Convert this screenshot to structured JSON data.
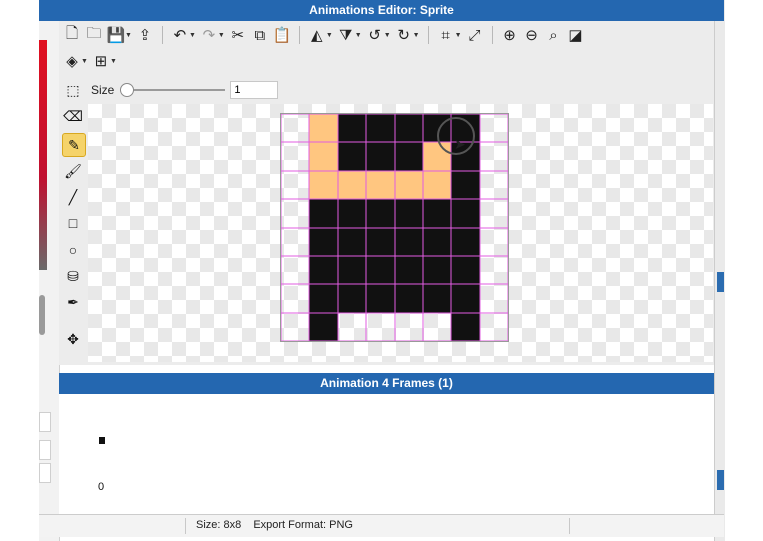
{
  "window": {
    "title": "Animations Editor: Sprite"
  },
  "toolbar": {
    "row1": [
      {
        "icon": "new-file-icon",
        "glyph": "🗋"
      },
      {
        "icon": "open-folder-icon",
        "glyph": "🗀"
      },
      {
        "icon": "save-icon",
        "glyph": "💾",
        "caret": true
      },
      {
        "icon": "export-icon",
        "glyph": "⇪"
      },
      {
        "sep": true
      },
      {
        "icon": "undo-icon",
        "glyph": "↶",
        "caret": true
      },
      {
        "icon": "redo-icon",
        "glyph": "↷",
        "caret": true,
        "disabled": true
      },
      {
        "icon": "cut-icon",
        "glyph": "✂"
      },
      {
        "icon": "copy-icon",
        "glyph": "⧉"
      },
      {
        "icon": "paste-icon",
        "glyph": "📋"
      },
      {
        "sep": true
      },
      {
        "icon": "flip-horizontal-icon",
        "glyph": "◭",
        "caret": true
      },
      {
        "icon": "flip-vertical-icon",
        "glyph": "⧩",
        "caret": true
      },
      {
        "icon": "rotate-left-icon",
        "glyph": "↺",
        "caret": true
      },
      {
        "icon": "rotate-right-icon",
        "glyph": "↻",
        "caret": true
      },
      {
        "sep": true
      },
      {
        "icon": "crop-icon",
        "glyph": "⌗",
        "caret": true
      },
      {
        "icon": "resize-icon",
        "glyph": "⤢"
      },
      {
        "sep": true
      },
      {
        "icon": "zoom-in-icon",
        "glyph": "⊕"
      },
      {
        "icon": "zoom-out-icon",
        "glyph": "⊖"
      },
      {
        "icon": "zoom-fit-icon",
        "glyph": "⌕"
      },
      {
        "icon": "background-toggle-icon",
        "glyph": "◪"
      }
    ],
    "row2": [
      {
        "icon": "layers-icon",
        "glyph": "◈",
        "caret": true
      },
      {
        "icon": "grid-icon",
        "glyph": "⊞",
        "caret": true
      }
    ]
  },
  "size": {
    "label": "Size",
    "value": "1",
    "slider_fraction": 0
  },
  "tools": [
    {
      "icon": "selection-icon",
      "glyph": "⬚"
    },
    {
      "icon": "eraser-icon",
      "glyph": "⌫"
    },
    {
      "icon": "pencil-icon",
      "glyph": "✎",
      "active": true
    },
    {
      "icon": "brush-icon",
      "glyph": "🖌"
    },
    {
      "icon": "line-icon",
      "glyph": "╱"
    },
    {
      "icon": "rectangle-icon",
      "glyph": "□"
    },
    {
      "icon": "circle-icon",
      "glyph": "○"
    },
    {
      "icon": "fill-icon",
      "glyph": "⛁"
    },
    {
      "icon": "eyedropper-icon",
      "glyph": "✒"
    },
    {
      "icon": "pan-icon",
      "glyph": "✥"
    }
  ],
  "sprite": {
    "columns": 8,
    "rows": 8,
    "palette": {
      "0": "transparent",
      "1": "#111111",
      "2": "#ffc680"
    },
    "pixels": [
      [
        0,
        2,
        1,
        1,
        1,
        1,
        1,
        0
      ],
      [
        0,
        2,
        1,
        1,
        1,
        2,
        1,
        0
      ],
      [
        0,
        2,
        2,
        2,
        2,
        2,
        1,
        0
      ],
      [
        0,
        1,
        1,
        1,
        1,
        1,
        1,
        0
      ],
      [
        0,
        1,
        1,
        1,
        1,
        1,
        1,
        0
      ],
      [
        0,
        1,
        1,
        1,
        1,
        1,
        1,
        0
      ],
      [
        0,
        1,
        1,
        1,
        1,
        1,
        1,
        0
      ],
      [
        0,
        1,
        0,
        0,
        0,
        0,
        1,
        0
      ]
    ]
  },
  "animation": {
    "header": "Animation 4 Frames (1)",
    "frame_index": "0"
  },
  "status": {
    "size": "Size: 8x8",
    "export_format": "Export Format: PNG"
  }
}
